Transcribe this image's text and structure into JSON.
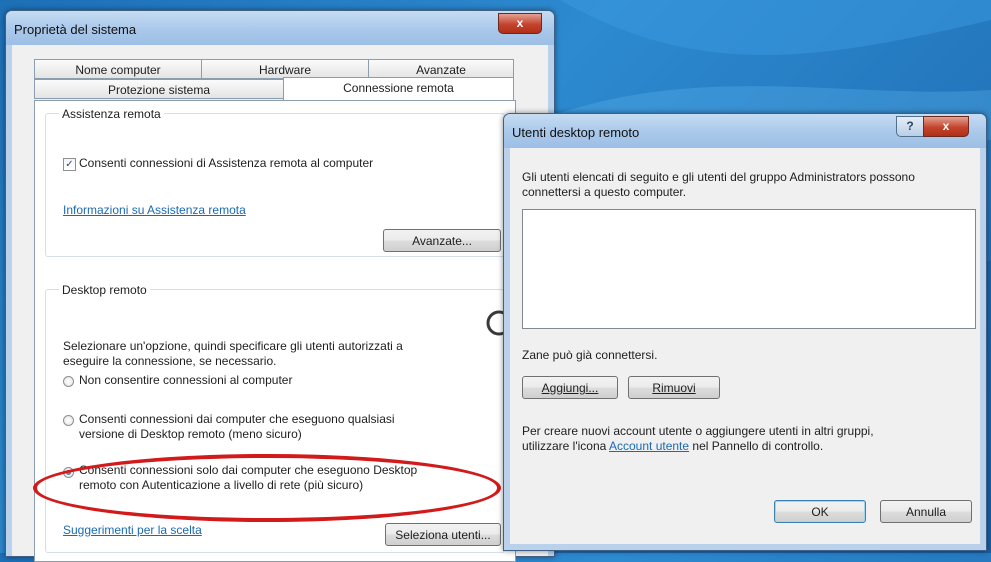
{
  "colors": {
    "annotation": "#d21a1a",
    "link": "#1b69b5",
    "desktop": "#1d6fb6"
  },
  "system_props": {
    "title": "Proprietà del sistema",
    "close_label": "x",
    "tabs_row1": [
      "Nome computer",
      "Hardware",
      "Avanzate"
    ],
    "tabs_row2": [
      "Protezione sistema",
      "Connessione remota"
    ],
    "assistenza": {
      "group_label": "Assistenza remota",
      "checkbox_label": "Consenti connessioni di Assistenza remota al computer",
      "checkbox_checked": true,
      "info_link": "Informazioni su Assistenza remota",
      "advanced_button": "Avanzate..."
    },
    "desktop": {
      "group_label": "Desktop remoto",
      "description_line1": "Selezionare un'opzione, quindi specificare gli utenti autorizzati a",
      "description_line2": "eseguire la connessione, se necessario.",
      "option1": "Non consentire connessioni al computer",
      "option2_line1": "Consenti connessioni dai computer che eseguono qualsiasi",
      "option2_line2": "versione di Desktop remoto (meno sicuro)",
      "option3_line1": "Consenti connessioni solo dai computer che eseguono Desktop",
      "option3_line2": "remoto con Autenticazione a livello di rete (più sicuro)",
      "selected_option": 3,
      "help_link": "Suggerimenti per la scelta",
      "select_users_button": "Seleziona utenti..."
    }
  },
  "users_dialog": {
    "title": "Utenti desktop remoto",
    "help_label": "?",
    "close_label": "x",
    "intro_line1": "Gli utenti elencati di seguito e gli utenti del gruppo Administrators possono",
    "intro_line2": "connettersi a questo computer.",
    "status_text": "Zane può già connettersi.",
    "add_button": "Aggiungi...",
    "remove_button": "Rimuovi",
    "footer_line1": "Per creare nuovi account utente o aggiungere utenti in altri gruppi,",
    "footer_prefix": "utilizzare l'icona ",
    "footer_link": "Account utente",
    "footer_suffix": " nel Pannello di controllo.",
    "ok_button": "OK",
    "cancel_button": "Annulla"
  },
  "icons": {
    "magnifier": "magnifier-icon"
  }
}
